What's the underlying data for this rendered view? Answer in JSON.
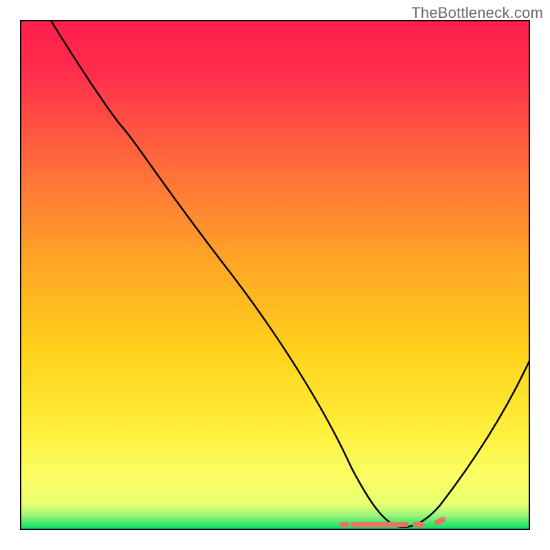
{
  "watermark": "TheBottleneck.com",
  "chart_data": {
    "type": "line",
    "title": "",
    "xlabel": "",
    "ylabel": "",
    "xlim": [
      0,
      100
    ],
    "ylim": [
      0,
      100
    ],
    "grid": false,
    "gradient": {
      "top": "#FF1F4B",
      "mid": "#FFC600",
      "low": "#FFFF6A",
      "bottom": "#00E060"
    },
    "curve": {
      "description": "Black V-shaped curve starting at top-left, descending with a slight knee, reaching a minimum near x≈74, then rising to the right edge.",
      "points_xy_pct": [
        [
          6,
          100
        ],
        [
          20,
          79
        ],
        [
          24,
          74
        ],
        [
          40,
          48
        ],
        [
          55,
          23
        ],
        [
          65,
          6
        ],
        [
          70,
          1
        ],
        [
          74,
          0
        ],
        [
          78,
          1
        ],
        [
          85,
          8
        ],
        [
          95,
          24
        ],
        [
          100,
          33
        ]
      ]
    },
    "bottom_marker": {
      "description": "Salmon dashed segment along y≈0 indicating the low-bottleneck zone",
      "x_start_pct": 63,
      "x_end_pct": 83,
      "color": "#E57368"
    }
  }
}
